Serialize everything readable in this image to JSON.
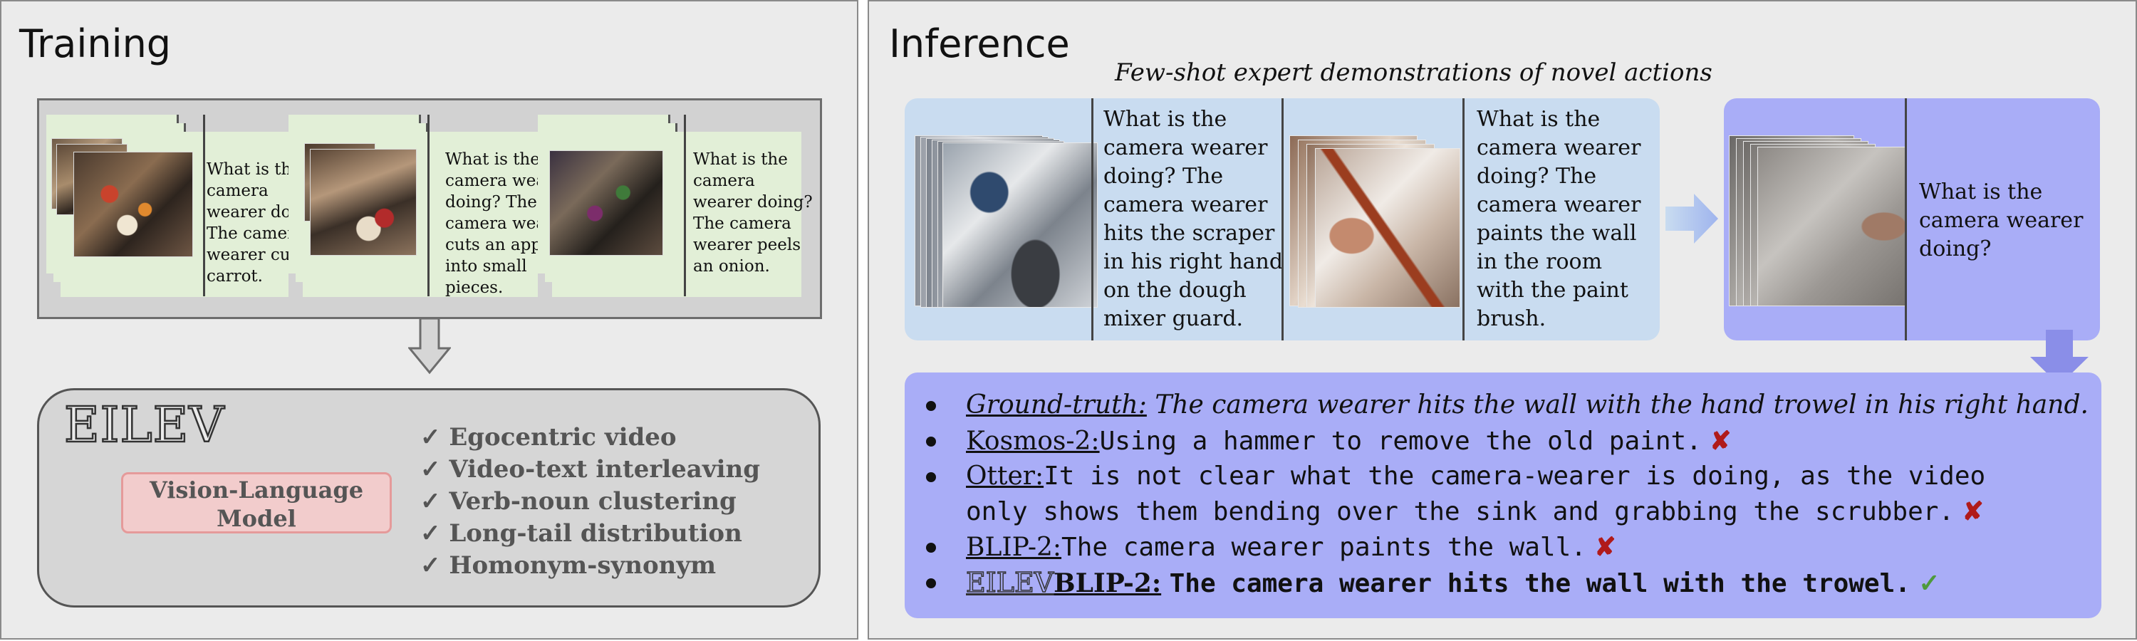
{
  "training": {
    "title": "Training",
    "examples": [
      {
        "text_lines": [
          "What is the",
          "camera",
          "wearer doing?",
          "The camera",
          "wearer cuts a",
          "carrot."
        ]
      },
      {
        "text_lines": [
          "What is the",
          "camera wearer",
          "doing? The",
          "camera wearer",
          "cuts an apple",
          "into small",
          "pieces."
        ]
      },
      {
        "text_lines": [
          "What is the",
          "camera",
          "wearer doing?",
          "The camera",
          "wearer peels",
          "an onion."
        ]
      }
    ],
    "model": {
      "logo": "EILEV",
      "vlm_lines": [
        "Vision-Language",
        "Model"
      ],
      "features": [
        "✓ Egocentric video",
        "✓ Video-text interleaving",
        "✓ Verb-noun clustering",
        "✓ Long-tail distribution",
        "✓ Homonym-synonym"
      ]
    }
  },
  "inference": {
    "title": "Inference",
    "subtitle": "Few-shot expert demonstrations of novel actions",
    "demos": [
      {
        "text_lines": [
          "What is the",
          "camera wearer",
          "doing? The",
          "camera wearer",
          "hits the scraper",
          "in his right hand",
          "on the dough",
          "mixer guard."
        ]
      },
      {
        "text_lines": [
          "What is the",
          "camera wearer",
          "doing? The",
          "camera wearer",
          "paints the wall",
          "in the room",
          "with the paint",
          "brush."
        ]
      }
    ],
    "query_lines": [
      "What is the",
      "camera wearer",
      "doing?"
    ],
    "results": [
      {
        "label": "Ground-truth:",
        "text": " The camera wearer hits the wall with the hand trowel in his right hand.",
        "mark": ""
      },
      {
        "label": "Kosmos-2:",
        "text": "Using a hammer to remove the old paint.",
        "mark": "✘"
      },
      {
        "label": "Otter:",
        "text": "It is not clear what the camera-wearer is doing, as the video",
        "text2": "only shows them bending over the sink and grabbing the scrubber.",
        "mark": "✘"
      },
      {
        "label": "BLIP-2:",
        "text": "The camera wearer paints the wall.",
        "mark": "✘"
      },
      {
        "logo": "EILEV",
        "label": "BLIP-2:",
        "text": "The camera wearer hits the wall with the trowel.",
        "mark": "✓"
      }
    ],
    "bullet": "●"
  },
  "colors": {
    "panel_bg": "#ebebeb",
    "train_card": "#e2efd7",
    "demo_bg": "#c9dcf0",
    "query_bg": "#a9adf7",
    "vlm_fill": "#f2cccc",
    "wrong": "#b01a1a",
    "correct": "#4e9a3c"
  }
}
